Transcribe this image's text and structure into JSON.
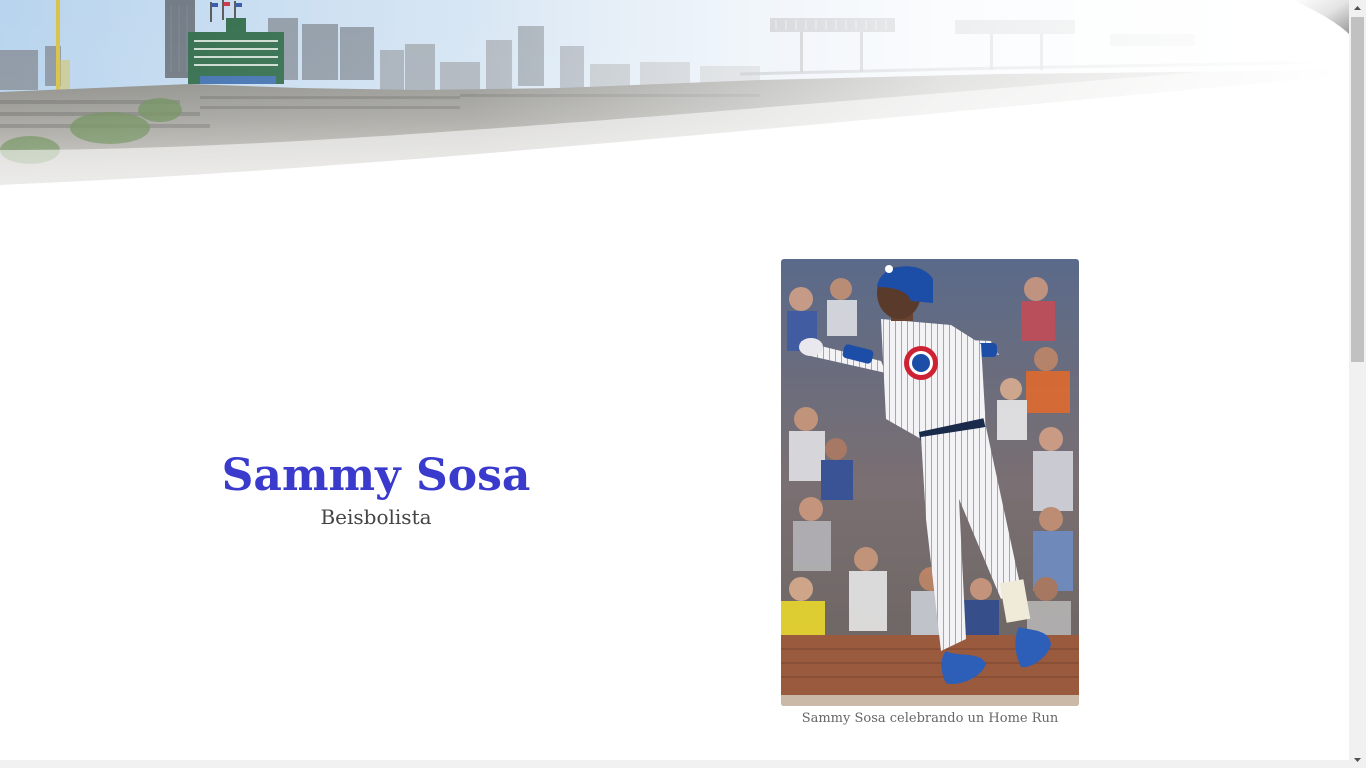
{
  "hero": {
    "name": "Sammy Sosa",
    "role": "Beisbolista"
  },
  "figure": {
    "caption": "Sammy Sosa celebrando un Home Run",
    "image_description": "Sammy Sosa in Chicago Cubs pinstripe uniform and blue helmet, arms spread, celebrating in front of a crowd"
  },
  "banner": {
    "image_description": "Faded panorama of Wrigley Field with scoreboard, rooftop stands and the Chicago skyline"
  },
  "colors": {
    "name": "#3a3acd",
    "role": "#444444",
    "caption": "#666666",
    "cubs_blue": "#1c4ea8",
    "cubs_red": "#cc2233"
  }
}
